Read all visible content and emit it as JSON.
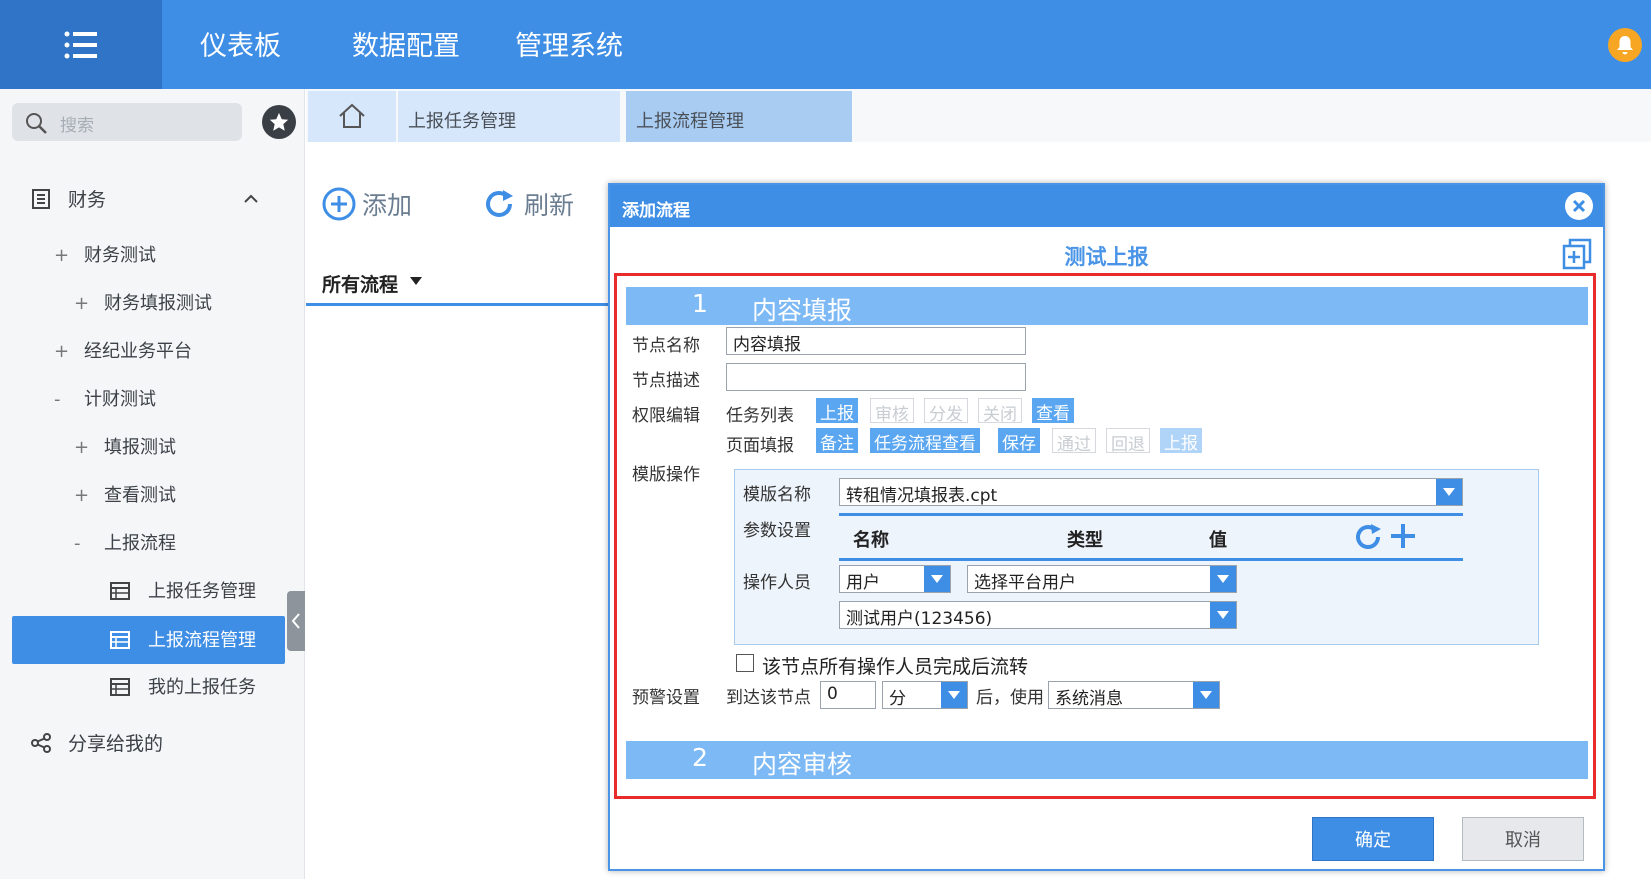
{
  "topnav": [
    "仪表板",
    "数据配置",
    "管理系统"
  ],
  "sidebar": {
    "search_placeholder": "搜索",
    "group_label": "财务",
    "items": [
      {
        "prefix": "+",
        "label": "财务测试"
      },
      {
        "prefix": "+",
        "label": "财务填报测试"
      },
      {
        "prefix": "+",
        "label": "经纪业务平台"
      },
      {
        "prefix": "-",
        "label": "计财测试"
      },
      {
        "prefix": "+",
        "label": "填报测试"
      },
      {
        "prefix": "+",
        "label": "查看测试"
      },
      {
        "prefix": "-",
        "label": "上报流程"
      },
      {
        "prefix": "",
        "label": "上报任务管理"
      },
      {
        "prefix": "",
        "label": "上报流程管理"
      },
      {
        "prefix": "",
        "label": "我的上报任务"
      }
    ],
    "share_label": "分享给我的"
  },
  "tabs": [
    "上报任务管理",
    "上报流程管理"
  ],
  "toolbar": {
    "add": "添加",
    "refresh": "刷新",
    "filter": "所有流程"
  },
  "dialog": {
    "title": "添加流程",
    "flow_name": "测试上报",
    "section1": {
      "num": "1",
      "title": "内容填报"
    },
    "section2": {
      "num": "2",
      "title": "内容审核"
    },
    "node_name_label": "节点名称",
    "node_name_value": "内容填报",
    "node_desc_label": "节点描述",
    "node_desc_value": "",
    "perm_label": "权限编辑",
    "task_list_label": "任务列表",
    "task_list_perms": [
      {
        "label": "上报",
        "state": "on"
      },
      {
        "label": "审核",
        "state": "off"
      },
      {
        "label": "分发",
        "state": "off"
      },
      {
        "label": "关闭",
        "state": "off"
      },
      {
        "label": "查看",
        "state": "on"
      }
    ],
    "page_fill_label": "页面填报",
    "page_fill_perms": [
      {
        "label": "备注",
        "state": "on"
      },
      {
        "label": "任务流程查看",
        "state": "on"
      },
      {
        "label": "保存",
        "state": "on"
      },
      {
        "label": "通过",
        "state": "off"
      },
      {
        "label": "回退",
        "state": "off"
      },
      {
        "label": "上报",
        "state": "dim"
      }
    ],
    "tpl_op_label": "模版操作",
    "tpl_name_label": "模版名称",
    "tpl_name_value": "转租情况填报表.cpt",
    "param_label": "参数设置",
    "param_cols": [
      "名称",
      "类型",
      "值"
    ],
    "operator_label": "操作人员",
    "operator_type": "用户",
    "operator_select": "选择平台用户",
    "operator_user": "测试用户(123456)",
    "checkbox_label": "该节点所有操作人员完成后流转",
    "warn_label": "预警设置",
    "warn_prefix": "到达该节点",
    "warn_value": "0",
    "warn_unit": "分",
    "warn_mid": "后，使用",
    "warn_method": "系统消息",
    "confirm": "确定",
    "cancel": "取消"
  }
}
